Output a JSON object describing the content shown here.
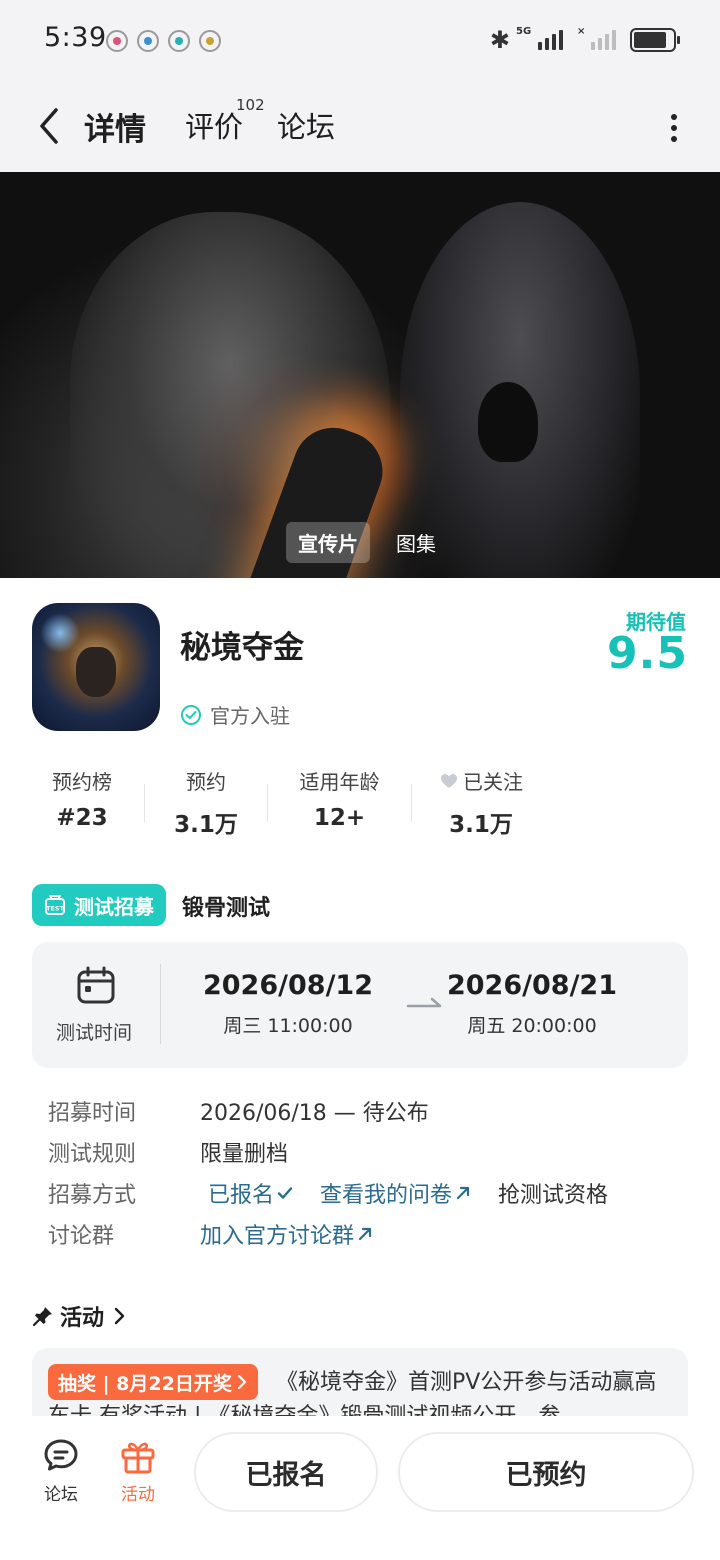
{
  "status_bar": {
    "time": "5:39",
    "signal_label": "5G",
    "battery_percent": 85
  },
  "header": {
    "tabs": [
      {
        "label": "详情",
        "active": true
      },
      {
        "label": "评价",
        "count": "102"
      },
      {
        "label": "论坛"
      }
    ]
  },
  "media": {
    "tabs": [
      "宣传片",
      "图集"
    ],
    "active_tab": "宣传片"
  },
  "game": {
    "title": "秘境夺金",
    "verified_text": "官方入驻",
    "expectation_label": "期待值",
    "expectation_value": "9.5"
  },
  "stats": [
    {
      "label": "预约榜",
      "value": "#23"
    },
    {
      "label": "预约",
      "value": "3.1万"
    },
    {
      "label": "适用年龄",
      "value": "12+"
    },
    {
      "label": "已关注",
      "value": "3.1万"
    }
  ],
  "test": {
    "badge": "测试招募",
    "name": "锻骨测试",
    "time_label": "测试时间",
    "start_date": "2026/08/12",
    "start_sub": "周三  11:00:00",
    "end_date": "2026/08/21",
    "end_sub": "周五  20:00:00",
    "rows": {
      "recruit_time_key": "招募时间",
      "recruit_time_val": "2026/06/18 — 待公布",
      "rules_key": "测试规则",
      "rules_val": "限量删档",
      "method_key": "招募方式",
      "method_registered": "已报名",
      "method_questionnaire": "查看我的问卷",
      "method_qualify": "抢测试资格",
      "group_key": "讨论群",
      "group_val": "加入官方讨论群"
    }
  },
  "activity": {
    "title": "活动",
    "badge": "抽奖 | 8月22日开奖",
    "text": "《秘境夺金》首测PV公开参与活动赢高车卡 有奖活动 | 《秘境夺金》锻骨测试视频公开，参"
  },
  "bottom_bar": {
    "forum_label": "论坛",
    "activity_label": "活动",
    "registered_button": "已报名",
    "reserved_button": "已预约"
  },
  "colors": {
    "accent": "#21cbbf",
    "orange": "#fa6a3e",
    "link": "#2a6b8f"
  },
  "icons": [
    "back-arrow-icon",
    "more-vertical-icon",
    "verified-check-icon",
    "heart-icon",
    "test-tube-icon",
    "calendar-icon",
    "arrow-right-icon",
    "external-link-icon",
    "check-icon",
    "pin-icon",
    "chevron-right-icon",
    "chat-bubble-icon",
    "gift-icon"
  ]
}
